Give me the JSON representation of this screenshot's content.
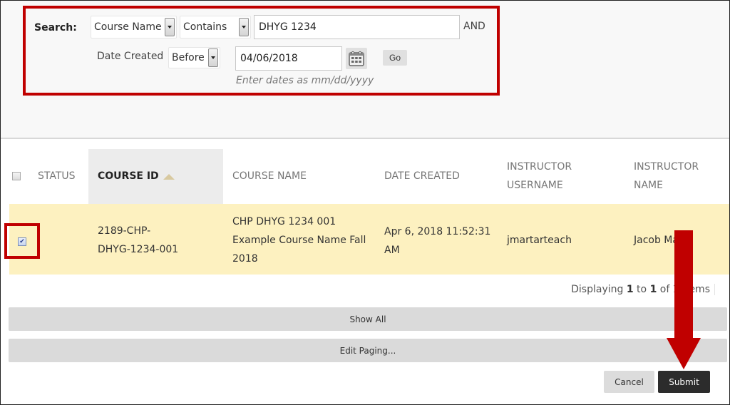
{
  "search": {
    "label": "Search:",
    "field_select": {
      "value": "Course Name"
    },
    "operator_select": {
      "value": "Contains"
    },
    "query_input": {
      "value": "DHYG 1234"
    },
    "conjunction": "AND",
    "date_label": "Date Created",
    "date_operator_select": {
      "value": "Before"
    },
    "date_input": {
      "value": "04/06/2018"
    },
    "calendar_icon": "calendar-icon",
    "go_label": "Go",
    "date_hint": "Enter dates as mm/dd/yyyy"
  },
  "table": {
    "columns": [
      {
        "key": "status",
        "label": "STATUS"
      },
      {
        "key": "course_id",
        "label": "COURSE ID",
        "sorted": "ascending"
      },
      {
        "key": "course_name",
        "label": "COURSE NAME"
      },
      {
        "key": "date_created",
        "label": "DATE CREATED"
      },
      {
        "key": "instructor_username",
        "label": "INSTRUCTOR USERNAME",
        "lines": [
          "INSTRUCTOR",
          "USERNAME"
        ]
      },
      {
        "key": "instructor_name",
        "label": "INSTRUCTOR NAME",
        "lines": [
          "INSTRUCTOR",
          "NAME"
        ]
      }
    ],
    "select_all_checked": false,
    "rows": [
      {
        "checked": true,
        "status": "",
        "course_id": "2189-CHP-DHYG-1234-001",
        "course_id_lines": [
          "2189-CHP-",
          "DHYG-1234-001"
        ],
        "course_name": "CHP DHYG 1234 001 Example Course Name Fall 2018",
        "course_name_lines": [
          "CHP DHYG 1234 001",
          "Example Course Name Fall",
          "2018"
        ],
        "date_created": "Apr 6, 2018 11:52:31 AM",
        "date_created_lines": [
          "Apr 6, 2018 11:52:31",
          "AM"
        ],
        "instructor_username": "jmartarteach",
        "instructor_name": "Jacob Martr"
      }
    ]
  },
  "pagination": {
    "prefix": "Displaying ",
    "from": "1",
    "to_word": " to ",
    "to": "1",
    "suffix": " of 1 items"
  },
  "buttons": {
    "show_all": "Show All",
    "edit_paging": "Edit Paging...",
    "cancel": "Cancel",
    "submit": "Submit"
  },
  "annotations": {
    "highlight_color": "#c00000",
    "arrow_direction": "down",
    "arrow_target": "submit-button"
  },
  "colors": {
    "selected_row": "#fdf1c0",
    "sorted_header": "#ececec",
    "submit_bg": "#2c2c2c",
    "bar_button_bg": "#dadada"
  }
}
